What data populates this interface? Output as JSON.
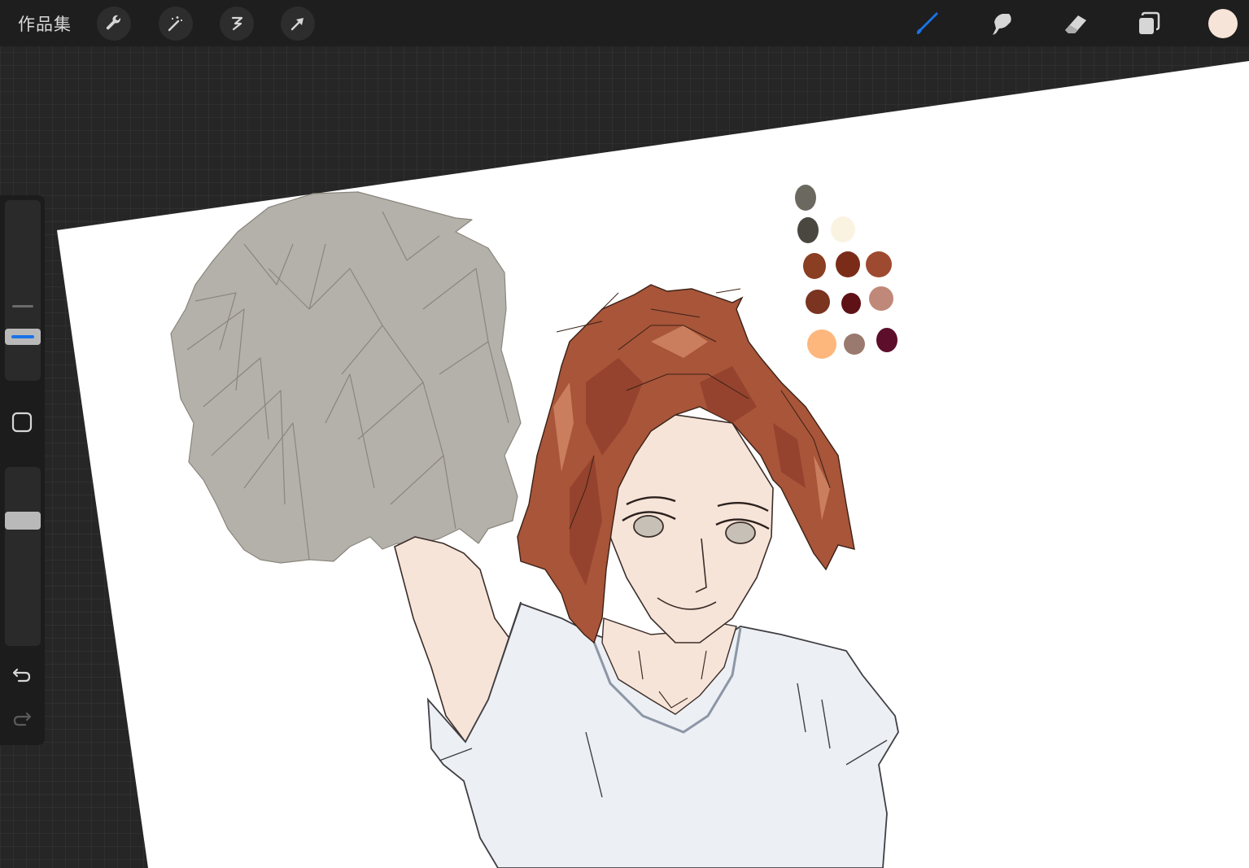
{
  "topbar": {
    "gallery_label": "作品集",
    "left_tools": [
      "wrench-icon",
      "magic-wand-icon",
      "selection-icon",
      "transform-arrow-icon"
    ],
    "right_tools": [
      "brush-icon",
      "smudge-icon",
      "eraser-icon",
      "layers-icon"
    ],
    "active_tool": "brush",
    "accent_color": "#1a73e8",
    "current_color": "#f7e4d8"
  },
  "sidebar": {
    "brush_size_slider": "size",
    "modify_button": "square-icon",
    "opacity_slider": "opacity",
    "undo": "undo-icon",
    "redo": "redo-icon"
  },
  "canvas": {
    "background": "#ffffff",
    "palette_colors": [
      "#6b6860",
      "#4a4640",
      "#fbf3e2",
      "#8a3e22",
      "#7a2c18",
      "#9e4a30",
      "#7a3420",
      "#5e1216",
      "#c08878",
      "#fdb77c",
      "#9a7a6e",
      "#5c0e2a"
    ]
  }
}
